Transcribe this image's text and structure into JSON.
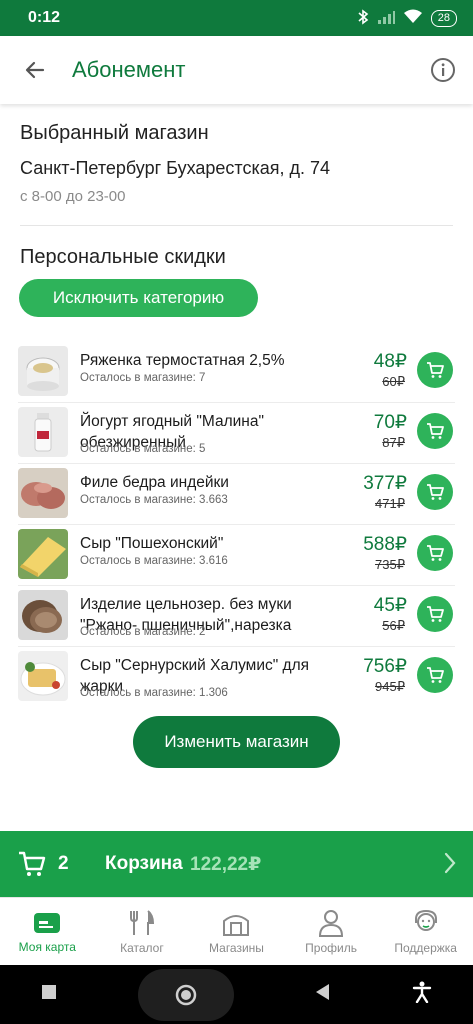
{
  "status": {
    "time": "0:12",
    "battery": "28"
  },
  "header": {
    "title": "Абонемент"
  },
  "store": {
    "section_title": "Выбранный магазин",
    "name": "Санкт-Петербург  Бухарестская, д. 74",
    "hours": "с 8-00 до 23-00"
  },
  "discounts": {
    "section_title": "Персональные скидки",
    "exclude_label": "Исключить категорию",
    "items": [
      {
        "name": "Ряженка термостатная 2,5%",
        "stock": "Осталось в магазине: 7",
        "price": "48₽",
        "old_price": "60₽"
      },
      {
        "name": "Йогурт ягодный \"Малина\" обезжиренный",
        "stock": "Осталось в магазине: 5",
        "price": "70₽",
        "old_price": "87₽"
      },
      {
        "name": "Филе бедра индейки",
        "stock": "Осталось в магазине: 3.663",
        "price": "377₽",
        "old_price": "471₽"
      },
      {
        "name": "Сыр \"Пошехонский\"",
        "stock": "Осталось в магазине: 3.616",
        "price": "588₽",
        "old_price": "735₽"
      },
      {
        "name": "Изделие цельнозер. без муки \"Ржано- пшеничный\",нарезка",
        "stock": "Осталось в магазине: 2",
        "price": "45₽",
        "old_price": "56₽"
      },
      {
        "name": "Сыр \"Сернурский Халумис\" для жарки",
        "stock": "Осталось в магазине: 1.306",
        "price": "756₽",
        "old_price": "945₽"
      }
    ]
  },
  "change_store_label": "Изменить магазин",
  "cart": {
    "count": "2",
    "label": "Корзина",
    "total": "122,22₽"
  },
  "nav": {
    "items": [
      {
        "label": "Моя карта"
      },
      {
        "label": "Каталог"
      },
      {
        "label": "Магазины"
      },
      {
        "label": "Профиль"
      },
      {
        "label": "Поддержка"
      }
    ]
  },
  "colors": {
    "primary": "#0f7a3d",
    "accent": "#2eb35a",
    "cartbar": "#1aa04a"
  }
}
